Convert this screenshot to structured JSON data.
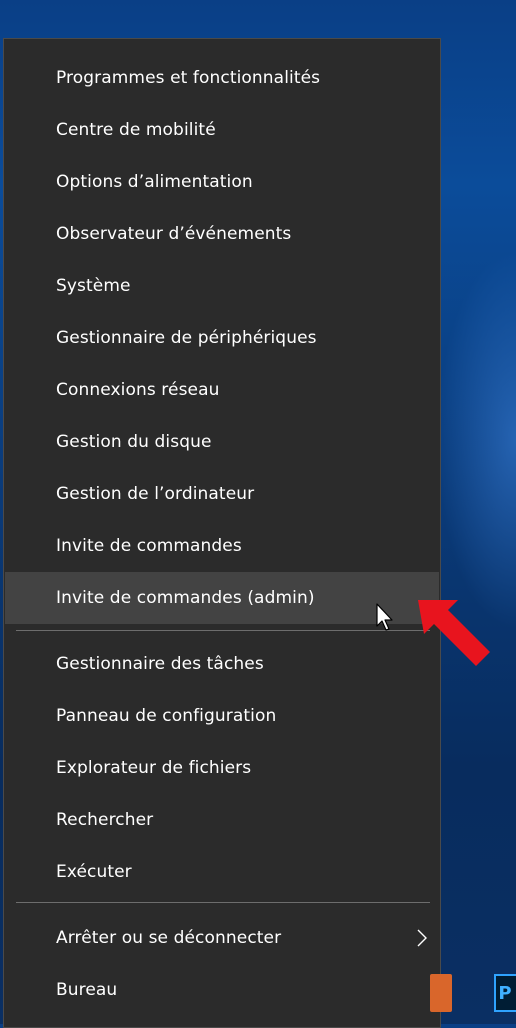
{
  "menu": {
    "items": [
      {
        "label": "Programmes et fonctionnalités"
      },
      {
        "label": "Centre de mobilité"
      },
      {
        "label": "Options d’alimentation"
      },
      {
        "label": "Observateur d’événements"
      },
      {
        "label": "Système"
      },
      {
        "label": "Gestionnaire de périphériques"
      },
      {
        "label": "Connexions réseau"
      },
      {
        "label": "Gestion du disque"
      },
      {
        "label": "Gestion de l’ordinateur"
      },
      {
        "label": "Invite de commandes"
      },
      {
        "label": "Invite de commandes (admin)",
        "highlighted": true
      },
      {
        "label": "Gestionnaire des tâches"
      },
      {
        "label": "Panneau de configuration"
      },
      {
        "label": "Explorateur de fichiers"
      },
      {
        "label": "Rechercher"
      },
      {
        "label": "Exécuter"
      },
      {
        "label": "Arrêter ou se déconnecter",
        "has_submenu": true
      },
      {
        "label": "Bureau"
      }
    ]
  },
  "taskbar": {
    "icon_letter": "P"
  },
  "colors": {
    "menu_background": "#2b2b2b",
    "highlight_background": "#434343",
    "text": "#ffffff",
    "annotation_arrow": "#e8141e"
  },
  "icons": {
    "submenu": "chevron-right-icon",
    "pointer": "mouse-cursor-icon",
    "annotation": "red-arrow-icon"
  }
}
